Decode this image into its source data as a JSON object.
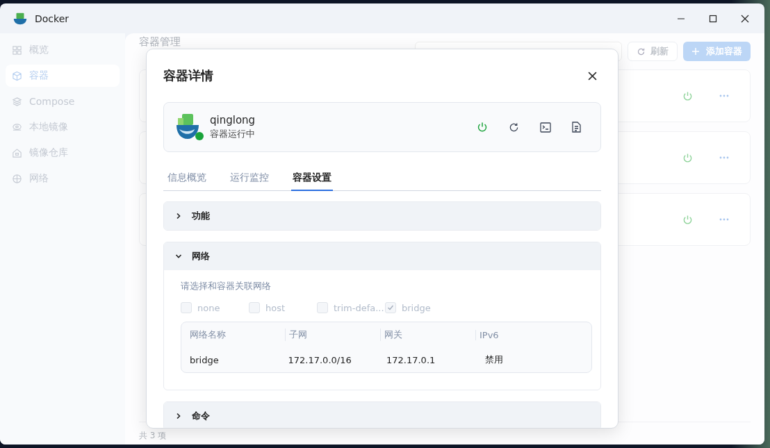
{
  "window": {
    "title": "Docker"
  },
  "sidebar": {
    "items": [
      {
        "label": "概览",
        "selected": false
      },
      {
        "label": "容器",
        "selected": true
      },
      {
        "label": "Compose",
        "selected": false
      },
      {
        "label": "本地镜像",
        "selected": false
      },
      {
        "label": "镜像仓库",
        "selected": false
      },
      {
        "label": "网络",
        "selected": false
      }
    ]
  },
  "page": {
    "title": "容器管理",
    "refresh_button": "刷新",
    "add_button": "添加容器",
    "container_cards": [
      {
        "running": true
      },
      {
        "running": true
      },
      {
        "running": true
      }
    ],
    "footer": "共 3 项"
  },
  "dialog": {
    "title": "容器详情",
    "container": {
      "name": "qinglong",
      "status": "容器运行中",
      "running": true
    },
    "tabs": [
      {
        "label": "信息概览",
        "selected": false
      },
      {
        "label": "运行监控",
        "selected": false
      },
      {
        "label": "容器设置",
        "selected": true
      }
    ],
    "sections": [
      {
        "title": "功能",
        "expanded": false
      },
      {
        "title": "网络",
        "expanded": true,
        "hint": "请选择和容器关联网络",
        "options": [
          {
            "label": "none",
            "checked": false
          },
          {
            "label": "host",
            "checked": false
          },
          {
            "label": "trim-defa...",
            "checked": false
          },
          {
            "label": "bridge",
            "checked": true
          }
        ],
        "table": {
          "columns": [
            "网络名称",
            "子网",
            "网关",
            "IPv6"
          ],
          "rows": [
            [
              "bridge",
              "172.17.0.0/16",
              "172.17.0.1",
              "禁用"
            ]
          ]
        }
      },
      {
        "title": "命令",
        "expanded": false
      }
    ]
  }
}
